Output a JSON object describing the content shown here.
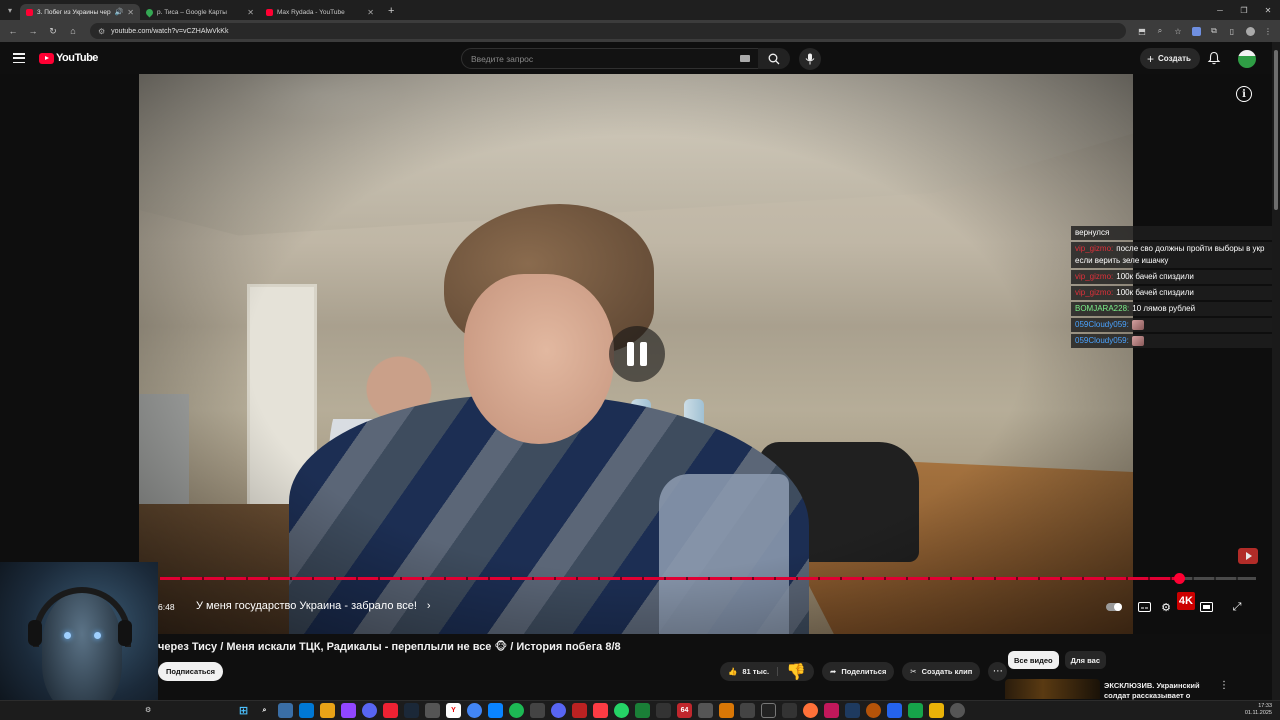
{
  "browser": {
    "tabs": [
      {
        "title": "3. Побег из Украины чер",
        "icon": "youtube-icon",
        "active": true,
        "audio": true
      },
      {
        "title": "р. Тиса – Google Карты",
        "icon": "maps-icon",
        "active": false
      },
      {
        "title": "Max Rydada - YouTube",
        "icon": "youtube-icon",
        "active": false
      }
    ],
    "url": "youtube.com/watch?v=vCZHAlwVkKk"
  },
  "header": {
    "logo_text": "YouTube",
    "search_placeholder": "Введите запрос",
    "create_label": "Создать"
  },
  "player": {
    "time": "6:48",
    "chapter_title": "У меня государство Украина - забрало все!",
    "progress_fraction": 0.93,
    "state": "paused"
  },
  "chat": [
    {
      "user": "",
      "user_color": "#ffffff",
      "text": "вернулся",
      "emote": false
    },
    {
      "user": "vip_gizmo",
      "user_color": "#e0303a",
      "text": "после сво должны пройти выборы в укр если верить зеле ишачку",
      "emote": false
    },
    {
      "user": "vip_gizmo",
      "user_color": "#e0303a",
      "text": "100к бачей спиздили",
      "emote": false
    },
    {
      "user": "vip_gizmo",
      "user_color": "#e0303a",
      "text": "100к бачей спиздили",
      "emote": false
    },
    {
      "user": "BOMJARA228",
      "user_color": "#7cf08a",
      "text": "10 лямов рублей",
      "emote": false
    },
    {
      "user": "059Cloudy059",
      "user_color": "#4aa3ff",
      "text": "",
      "emote": true
    },
    {
      "user": "059Cloudy059",
      "user_color": "#4aa3ff",
      "text": "",
      "emote": true
    }
  ],
  "video_info": {
    "title": "через Тису / Меня искали ТЦК, Радикалы - переплыли не все 🐵 / История побега 8/8",
    "subscribe_label": "Подписаться",
    "likes": "81 тыс.",
    "share_label": "Поделиться",
    "clip_label": "Создать клип"
  },
  "sidebar": {
    "chips": [
      "Все видео",
      "Для вас"
    ],
    "rec_title": "ЭКСКЛЮЗИВ. Украинский солдат рассказывает о"
  },
  "taskbar": {
    "clock_time": "17:33",
    "clock_date": "01.11.2025",
    "steam_count": "64"
  },
  "colors": {
    "accent": "#ff0033",
    "background": "#0f0f0f"
  }
}
